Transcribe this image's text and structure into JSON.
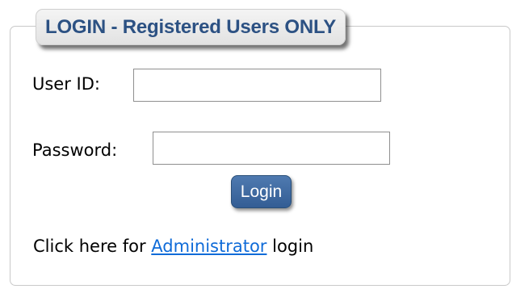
{
  "login": {
    "title": "LOGIN - Registered Users ONLY",
    "user_id_label": "User ID:",
    "user_id_value": "",
    "password_label": "Password:",
    "password_value": "",
    "login_button": "Login",
    "admin_prefix": "Click here for",
    "admin_link": "Administrator",
    "admin_suffix": "login"
  },
  "colors": {
    "title_text": "#2c5183",
    "button_bg": "#3a6299",
    "link": "#0f6bd8",
    "box_border": "#c9c9c9"
  }
}
